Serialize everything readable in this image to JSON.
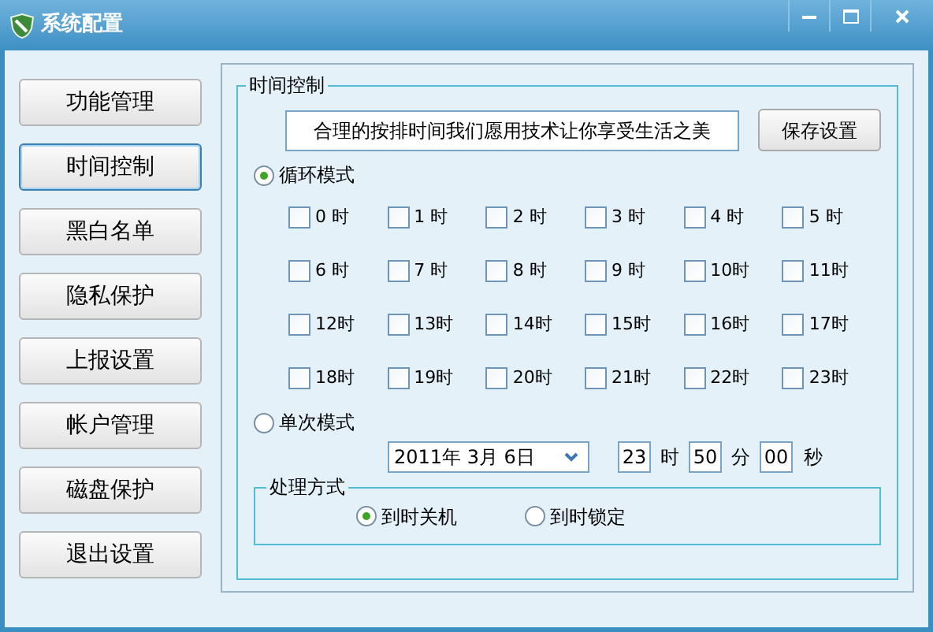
{
  "window": {
    "title": "系统配置"
  },
  "sidebar": {
    "items": [
      {
        "label": "功能管理",
        "selected": false
      },
      {
        "label": "时间控制",
        "selected": true
      },
      {
        "label": "黑白名单",
        "selected": false
      },
      {
        "label": "隐私保护",
        "selected": false
      },
      {
        "label": "上报设置",
        "selected": false
      },
      {
        "label": "帐户管理",
        "selected": false
      },
      {
        "label": "磁盘保护",
        "selected": false
      },
      {
        "label": "退出设置",
        "selected": false
      }
    ]
  },
  "time_control": {
    "title": "时间控制",
    "slogan": "合理的按排时间我们愿用技术让你享受生活之美",
    "save_button": "保存设置",
    "loop_mode": {
      "label": "循环模式",
      "selected": true
    },
    "hours": [
      {
        "label": "0 时",
        "checked": false
      },
      {
        "label": "1 时",
        "checked": false
      },
      {
        "label": "2 时",
        "checked": false
      },
      {
        "label": "3 时",
        "checked": false
      },
      {
        "label": "4 时",
        "checked": false
      },
      {
        "label": "5 时",
        "checked": false
      },
      {
        "label": "6 时",
        "checked": false
      },
      {
        "label": "7 时",
        "checked": false
      },
      {
        "label": "8 时",
        "checked": false
      },
      {
        "label": "9 时",
        "checked": false
      },
      {
        "label": "10时",
        "checked": false
      },
      {
        "label": "11时",
        "checked": false
      },
      {
        "label": "12时",
        "checked": false
      },
      {
        "label": "13时",
        "checked": false
      },
      {
        "label": "14时",
        "checked": false
      },
      {
        "label": "15时",
        "checked": false
      },
      {
        "label": "16时",
        "checked": false
      },
      {
        "label": "17时",
        "checked": false
      },
      {
        "label": "18时",
        "checked": false
      },
      {
        "label": "19时",
        "checked": false
      },
      {
        "label": "20时",
        "checked": false
      },
      {
        "label": "21时",
        "checked": false
      },
      {
        "label": "22时",
        "checked": false
      },
      {
        "label": "23时",
        "checked": false
      }
    ],
    "single_mode": {
      "label": "单次模式",
      "selected": false
    },
    "date": "2011年 3月 6日",
    "hour": "23",
    "hour_unit": "时",
    "minute": "50",
    "minute_unit": "分",
    "second": "00",
    "second_unit": "秒",
    "action": {
      "title": "处理方式",
      "options": [
        {
          "label": "到时关机",
          "selected": true
        },
        {
          "label": "到时锁定",
          "selected": false
        }
      ]
    }
  }
}
